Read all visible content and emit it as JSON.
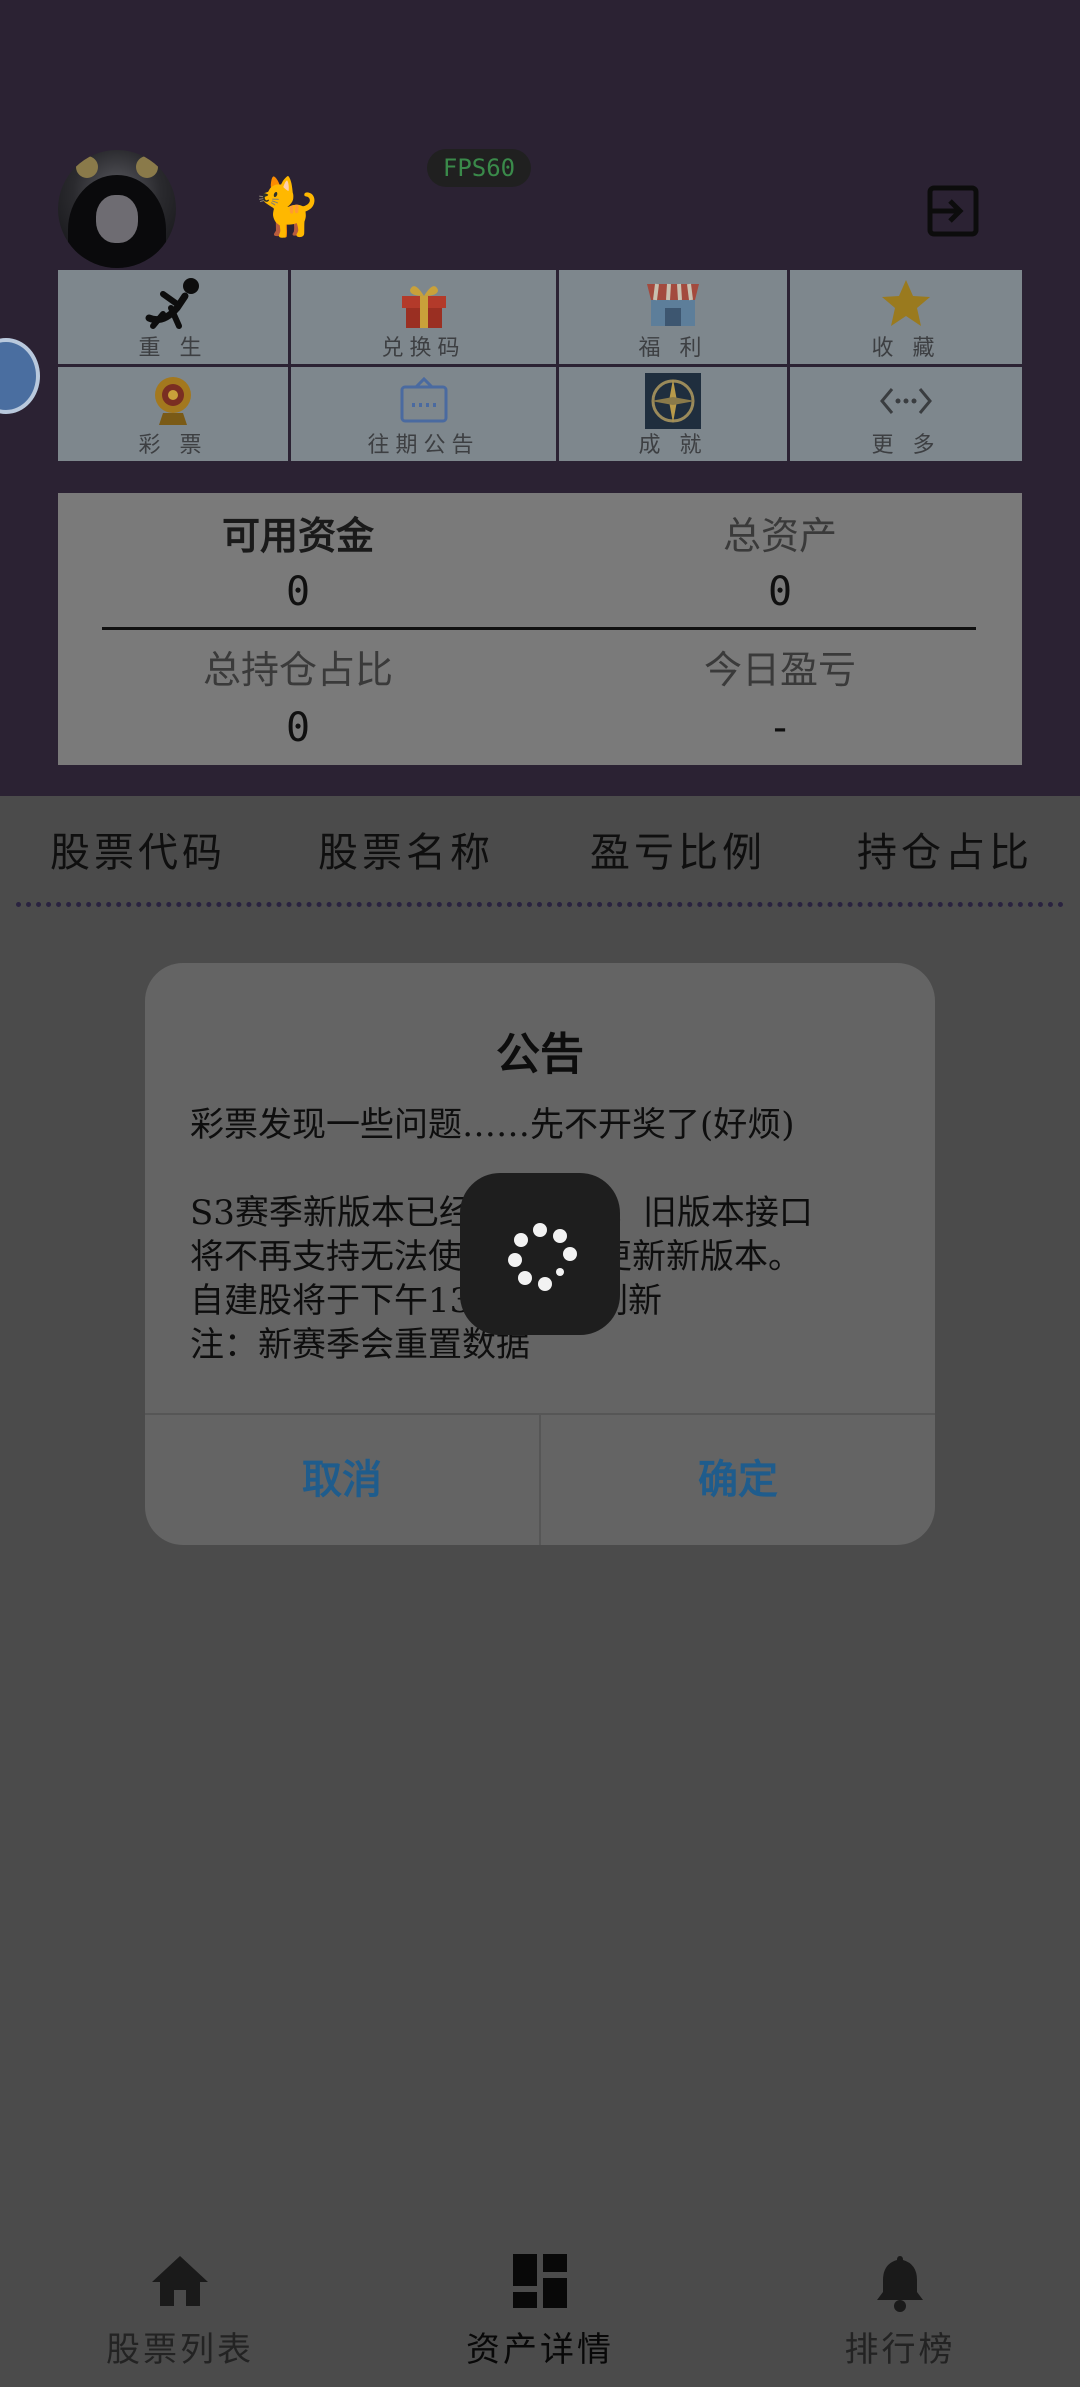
{
  "header": {
    "fps_badge": "FPS60",
    "avatar_alt": "user avatar",
    "pet_icon": "cat-emoji",
    "logout_icon": "logout-icon"
  },
  "menu": {
    "items": [
      {
        "label": "重 生",
        "icon": "falling-person-icon"
      },
      {
        "label": "兑换码",
        "icon": "gift-icon"
      },
      {
        "label": "福 利",
        "icon": "shop-icon"
      },
      {
        "label": "收 藏",
        "icon": "star-icon"
      },
      {
        "label": "彩 票",
        "icon": "lottery-wheel-icon"
      },
      {
        "label": "往期公告",
        "icon": "announcement-icon"
      },
      {
        "label": "成 就",
        "icon": "compass-icon"
      },
      {
        "label": "更 多",
        "icon": "more-icon"
      }
    ]
  },
  "stats": {
    "available_funds_label": "可用资金",
    "available_funds_value": "0",
    "total_assets_label": "总资产",
    "total_assets_value": "0",
    "position_ratio_label": "总持仓占比",
    "position_ratio_value": "0",
    "today_pnl_label": "今日盈亏",
    "today_pnl_value": "-"
  },
  "table": {
    "columns": [
      "股票代码",
      "股票名称",
      "盈亏比例",
      "持仓占比"
    ]
  },
  "dialog": {
    "title": "公告",
    "lines": [
      "彩票发现一些问题……先不开奖了(好烦)",
      "",
      "S3赛季新版本已经更新上线，旧版本接口",
      "将不再支持无法使用，建议更新新版本。",
      "自建股将于下午13:30开始刷新",
      "注：新赛季会重置数据"
    ],
    "cancel_label": "取消",
    "confirm_label": "确定"
  },
  "tabbar": {
    "items": [
      {
        "label": "股票列表",
        "icon": "home-icon",
        "active": false
      },
      {
        "label": "资产详情",
        "icon": "dashboard-icon",
        "active": true
      },
      {
        "label": "排行榜",
        "icon": "bell-icon",
        "active": false
      }
    ]
  },
  "colors": {
    "header_bg": "#2b2233",
    "overlay_bg": "#4b4b4b",
    "dialog_bg": "#646464",
    "button_text": "#1f5c8c"
  }
}
